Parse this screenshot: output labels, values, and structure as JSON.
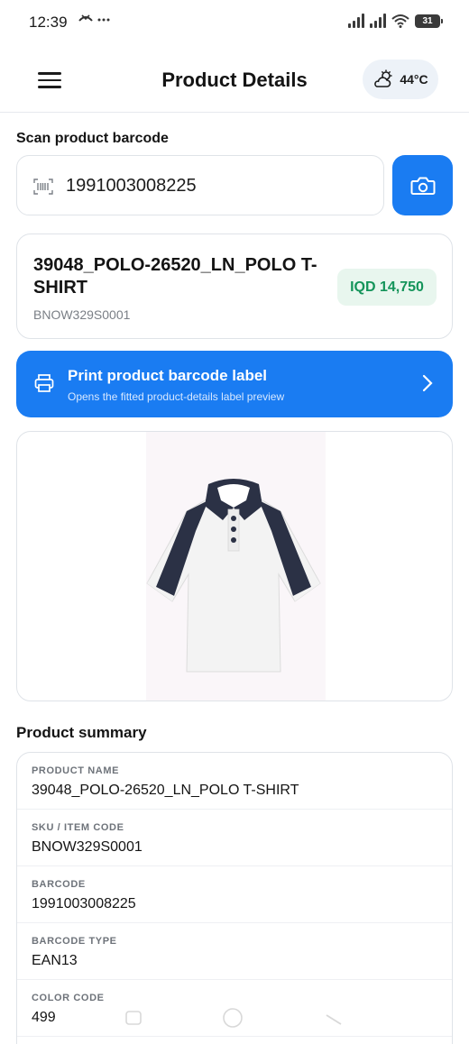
{
  "status_bar": {
    "time": "12:39",
    "left_icons": "℈ ···",
    "battery": "31"
  },
  "header": {
    "title": "Product Details",
    "weather": {
      "icon": "partly-cloudy-icon",
      "temperature": "44°C"
    }
  },
  "scan": {
    "label": "Scan product barcode",
    "value": "1991003008225",
    "camera_icon": "camera-icon"
  },
  "product": {
    "name": "39048_POLO-26520_LN_POLO T-SHIRT",
    "sku": "BNOW329S0001",
    "price": "IQD 14,750"
  },
  "print_label": {
    "title": "Print product barcode label",
    "subtitle": "Opens the fitted product-details label preview"
  },
  "summary": {
    "heading": "Product summary",
    "rows": [
      {
        "key": "PRODUCT NAME",
        "value": "39048_POLO-26520_LN_POLO T-SHIRT"
      },
      {
        "key": "SKU / ITEM CODE",
        "value": "BNOW329S0001"
      },
      {
        "key": "BARCODE",
        "value": "1991003008225"
      },
      {
        "key": "BARCODE TYPE",
        "value": "EAN13"
      },
      {
        "key": "COLOR CODE",
        "value": "499"
      }
    ]
  },
  "colors": {
    "accent": "#1a7cf2",
    "price_text": "#14945a",
    "price_bg": "#e8f6ee"
  }
}
